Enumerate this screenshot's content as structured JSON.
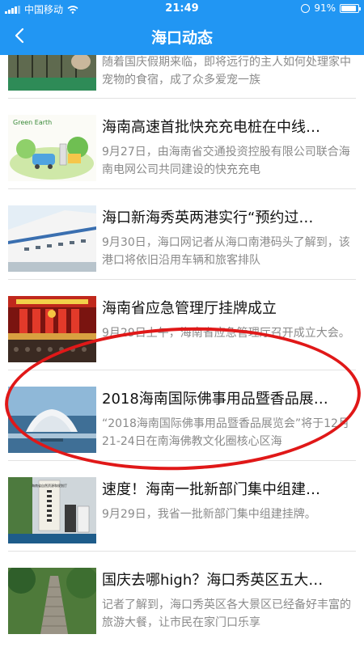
{
  "status": {
    "carrier": "中国移动",
    "time": "21:49",
    "battery": "91%",
    "battery_level": 0.91
  },
  "nav": {
    "title": "海口动态"
  },
  "articles": [
    {
      "title": "",
      "summary": "随着国庆假期来临，即将远行的主人如何处理家中宠物的食宿，成了众多爱宠一族",
      "thumb": "pets-thumb"
    },
    {
      "title": "海南高速首批快充充电桩在中线…",
      "summary": "9月27日，由海南省交通投资控股有限公司联合海南电网公司共同建设的快充充电",
      "thumb": "green-earth-thumb",
      "thumb_text": "Green Earth"
    },
    {
      "title": "海口新海秀英两港实行“预约过…",
      "summary": "9月30日，海口网记者从海口南港码头了解到，该港口将依旧沿用车辆和旅客排队",
      "thumb": "ship-thumb"
    },
    {
      "title": "海南省应急管理厅挂牌成立",
      "summary": "9月29日上午，海南省应急管理厅召开成立大会。",
      "thumb": "meeting-hall-thumb"
    },
    {
      "title": "2018海南国际佛事用品暨香品展…",
      "summary": "“2018海南国际佛事用品暨香品展览会”将于12月21-24日在南海佛教文化圈核心区海",
      "thumb": "lotus-building-thumb"
    },
    {
      "title": "速度！海南一批新部门集中组建…",
      "summary": "9月29日，我省一批新部门集中组建挂牌。",
      "thumb": "plaque-thumb",
      "thumb_text": "海南省自然资源和规划厅"
    },
    {
      "title": "国庆去哪high？海口秀英区五大…",
      "summary": "记者了解到，海口秀英区各大景区已经备好丰富的旅游大餐，让市民在家门口乐享",
      "thumb": "stairs-thumb"
    }
  ]
}
